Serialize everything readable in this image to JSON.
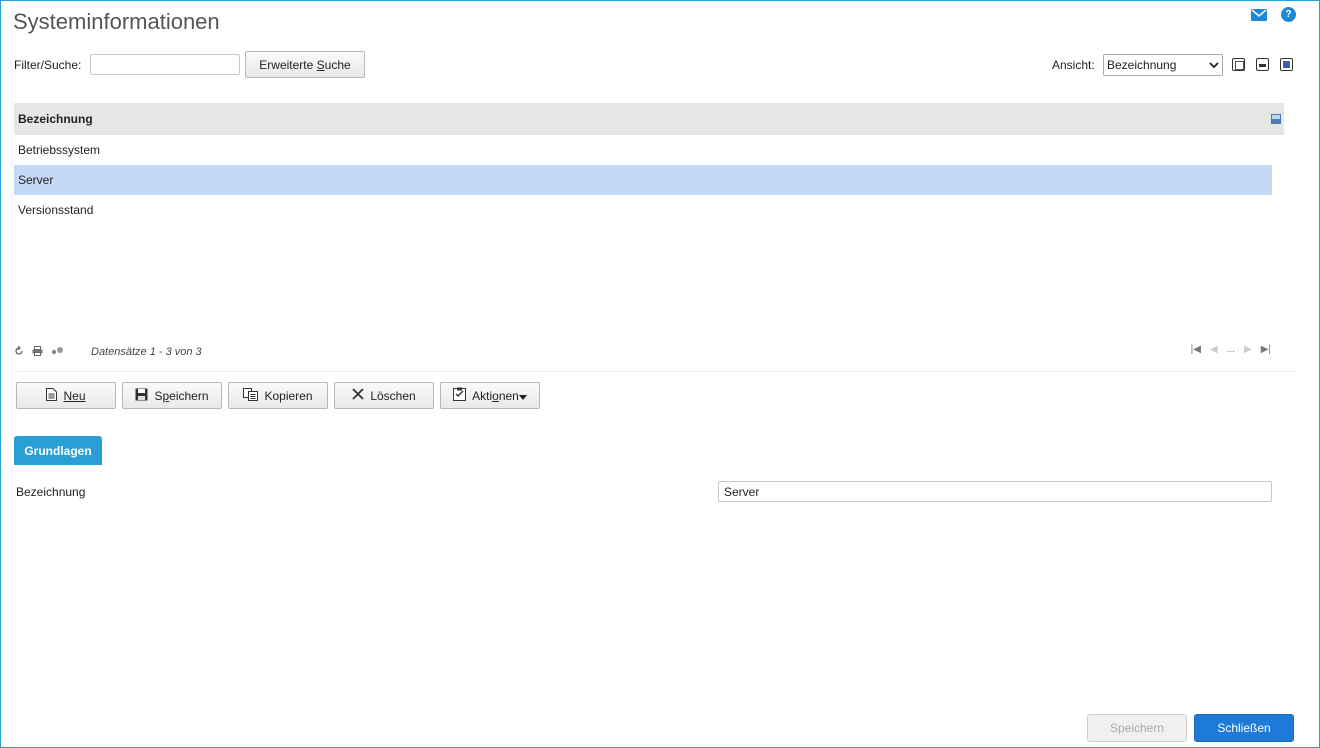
{
  "page": {
    "title": "Systeminformationen"
  },
  "icons": {
    "mail": "mail-icon",
    "help": "help-icon",
    "help_glyph": "?"
  },
  "filter": {
    "label": "Filter/Suche:",
    "value": "",
    "placeholder": "",
    "advanced_prefix": "Erweiterte ",
    "advanced_key": "S",
    "advanced_suffix": "uche"
  },
  "view": {
    "label": "Ansicht:",
    "selected": "Bezeichnung"
  },
  "grid": {
    "column_header": "Bezeichnung",
    "rows": [
      "Betriebssystem",
      "Server",
      "Versionsstand"
    ],
    "selected_index": 1,
    "records": "Datensätze 1 - 3 von 3",
    "pager_ellipsis": "..."
  },
  "toolbar": {
    "neu": "Neu",
    "speichern_pre": "S",
    "speichern_key": "p",
    "speichern_post": "eichern",
    "kopieren": "Kopieren",
    "loeschen": "Löschen",
    "aktionen_pre": "Akti",
    "aktionen_key": "o",
    "aktionen_post": "nen"
  },
  "tabs": {
    "grundlagen": "Grundlagen"
  },
  "form": {
    "bezeichnung_label": "Bezeichnung",
    "bezeichnung_value": "Server"
  },
  "footer": {
    "save": "Speichern",
    "close": "Schließen"
  },
  "colors": {
    "accent": "#2a9fd6",
    "selected_row": "#c5d9f6",
    "primary_button": "#1d7ad6"
  }
}
